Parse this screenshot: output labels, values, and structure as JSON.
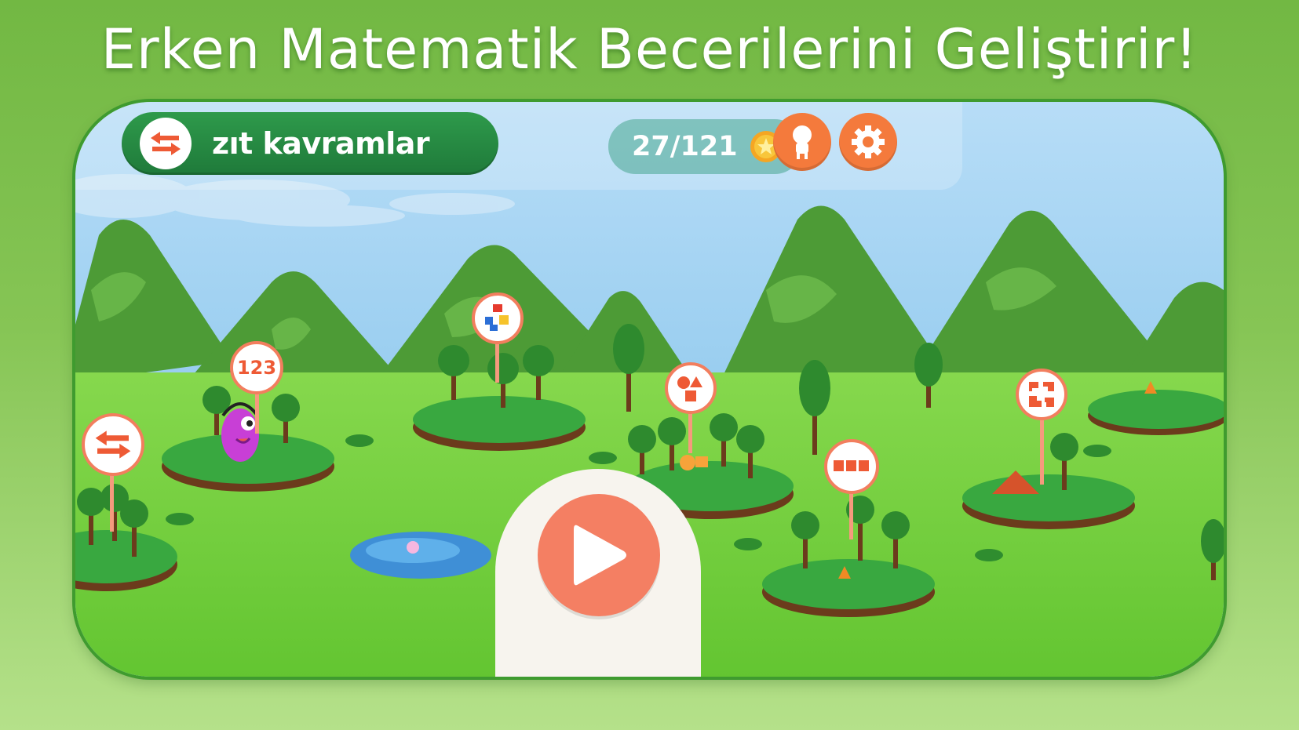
{
  "headline": "Erken Matematik Becerilerini Geliştirir!",
  "topbar": {
    "category_label": "zıt kavramlar",
    "category_icon": "swap-arrows-icon",
    "score_text": "27/121",
    "coin_icon": "coin-star-icon",
    "profile_icon": "profile-icon",
    "settings_icon": "gear-icon"
  },
  "map": {
    "signs": [
      {
        "id": "opposites",
        "icon": "swap-arrows-icon"
      },
      {
        "id": "numbers",
        "icon": "numbers-icon",
        "text": "123"
      },
      {
        "id": "sorting",
        "icon": "colored-blocks-icon"
      },
      {
        "id": "shapes",
        "icon": "shapes-icon"
      },
      {
        "id": "patterns",
        "icon": "squares-row-icon"
      },
      {
        "id": "puzzle",
        "icon": "puzzle-pieces-icon"
      }
    ],
    "character": "purple-monster-with-headphones"
  },
  "play_icon": "play-icon",
  "colors": {
    "accent_orange": "#f47a3c",
    "play_salmon": "#f47f63",
    "category_green": "#1f7a3a",
    "sky": "#8ccbf2",
    "grass": "#7ed447"
  }
}
